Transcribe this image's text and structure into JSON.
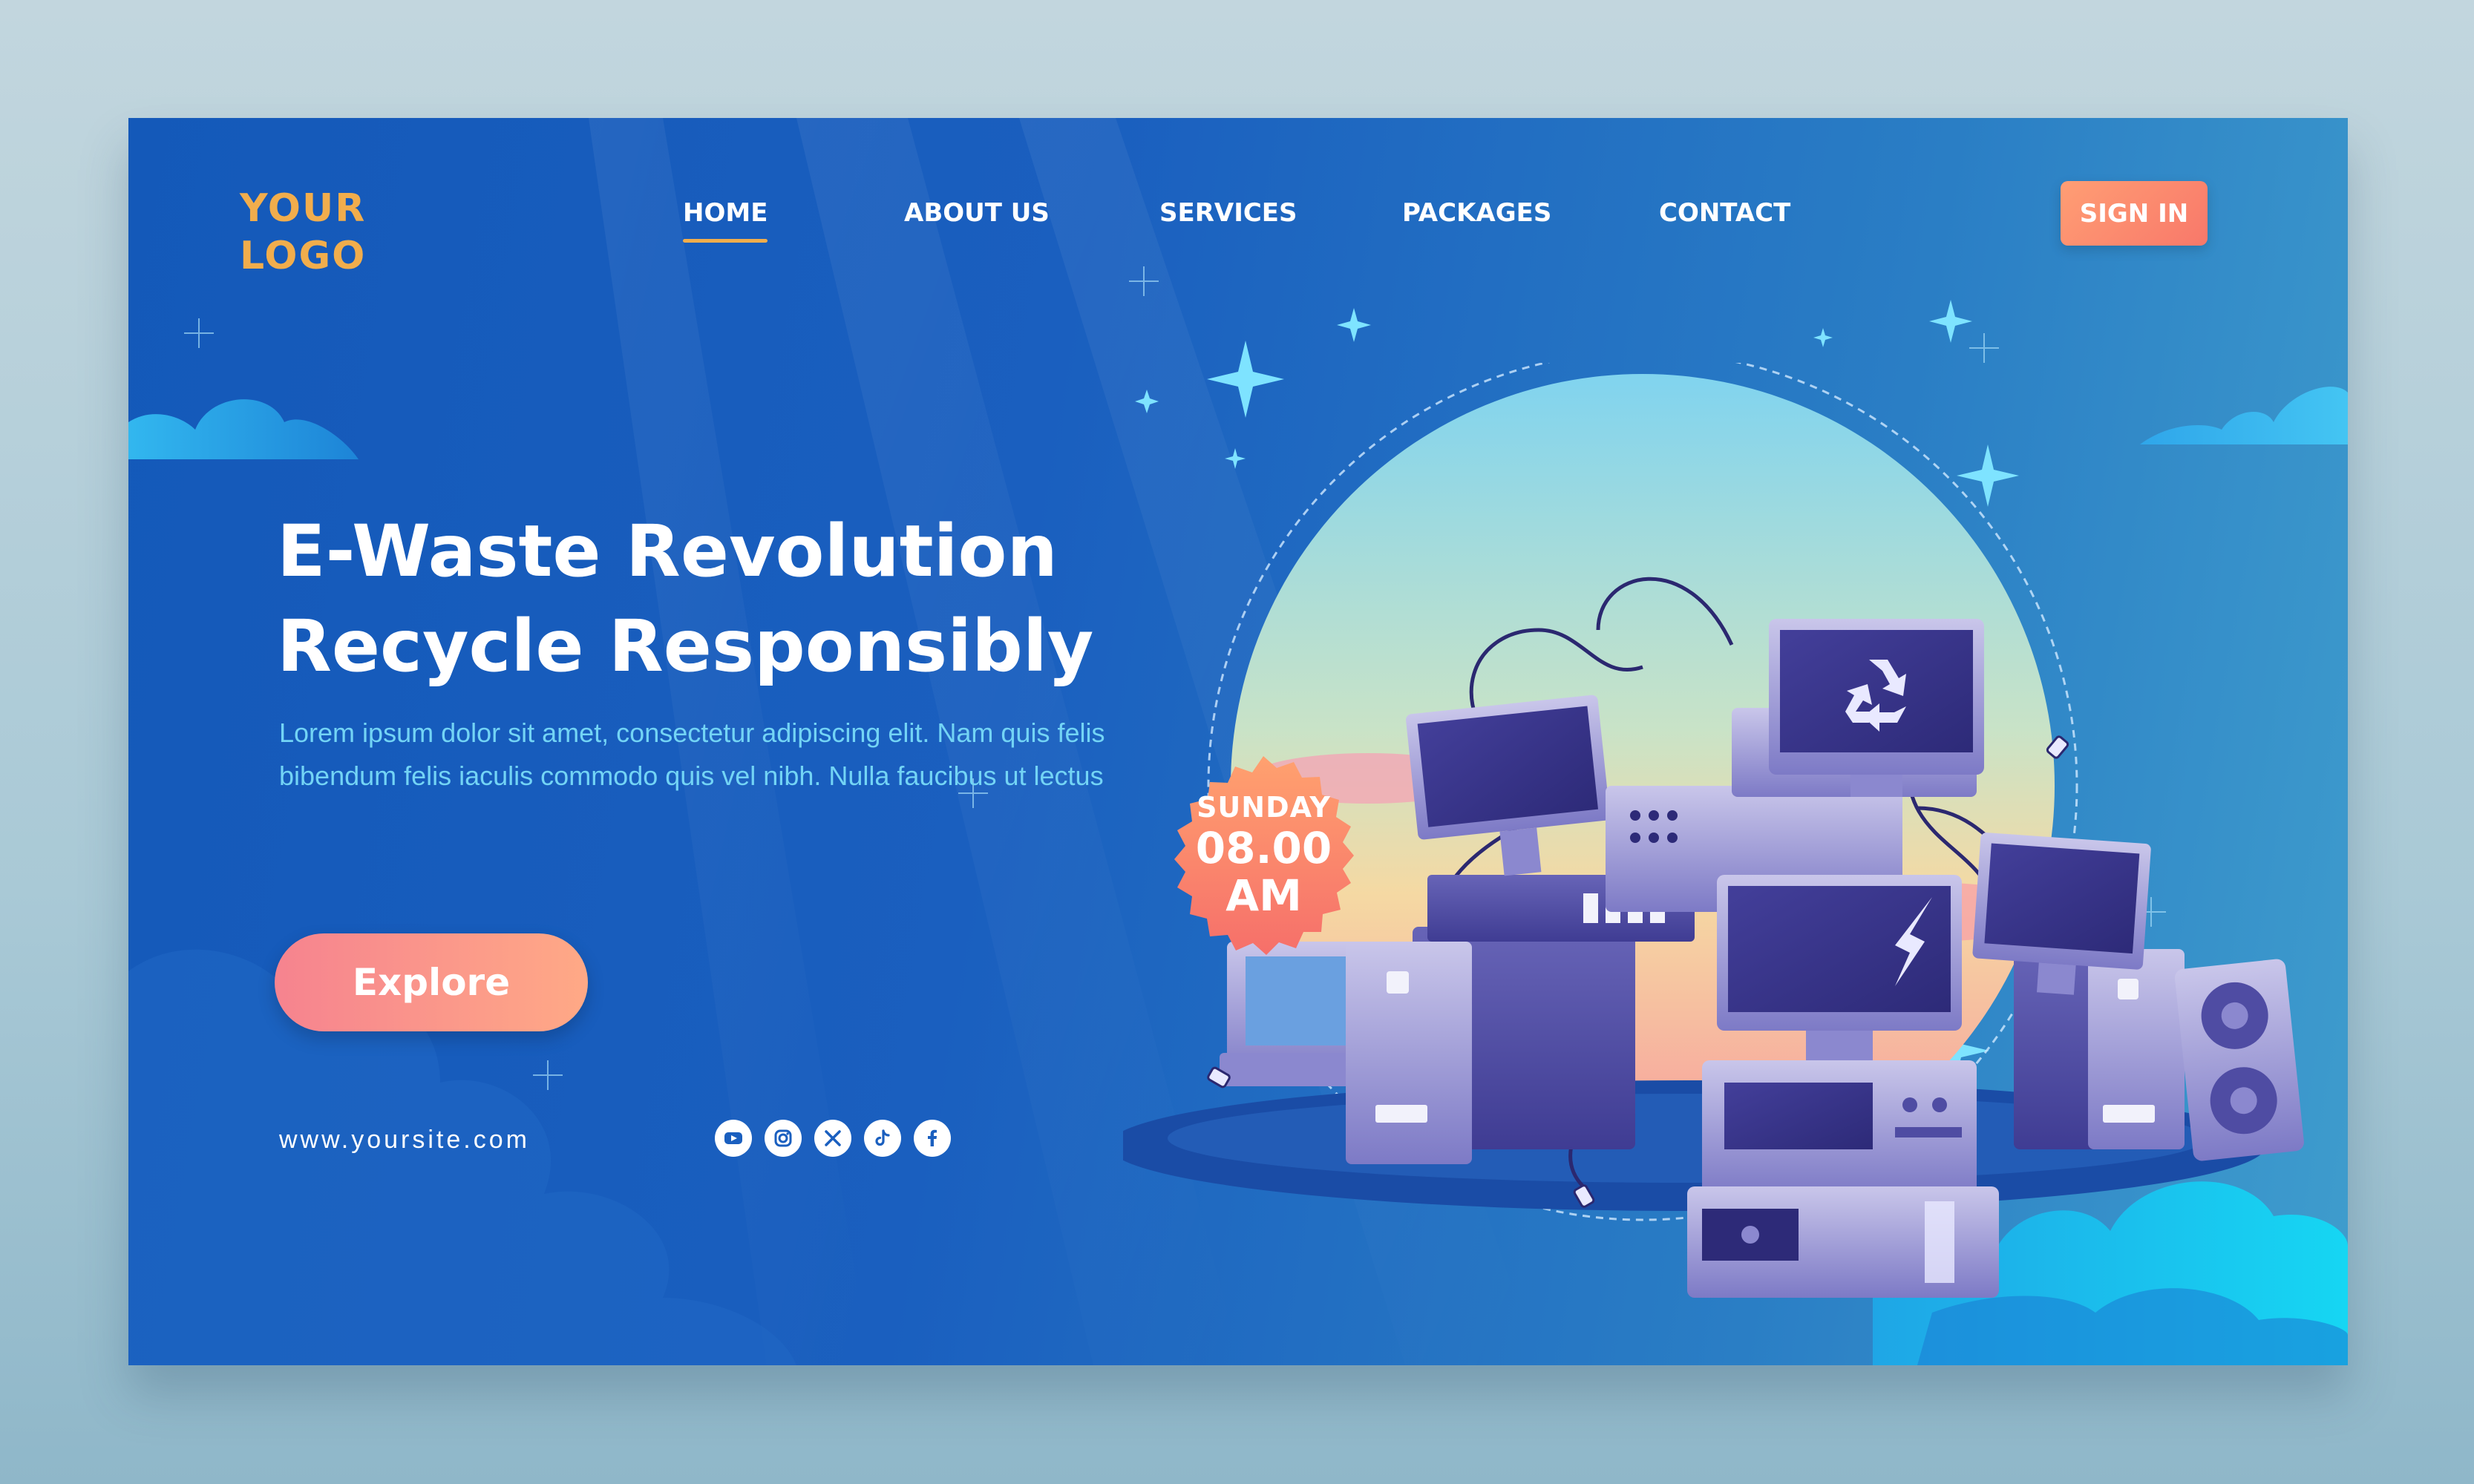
{
  "logo": {
    "text": "YOUR\nLOGO"
  },
  "nav": {
    "items": [
      {
        "label": "HOME",
        "active": true
      },
      {
        "label": "ABOUT US",
        "active": false
      },
      {
        "label": "SERVICES",
        "active": false
      },
      {
        "label": "PACKAGES",
        "active": false
      },
      {
        "label": "CONTACT",
        "active": false
      }
    ],
    "signin_label": "SIGN IN"
  },
  "hero": {
    "title_line1": "E-Waste Revolution",
    "title_line2": "Recycle Responsibly",
    "description": "Lorem ipsum dolor sit amet, consectetur adipiscing elit. Nam quis felis bibendum felis iaculis commodo quis vel nibh. Nulla faucibus ut lectus",
    "explore_label": "Explore"
  },
  "footer": {
    "website": "www.yoursite.com",
    "socials": [
      "youtube-icon",
      "instagram-icon",
      "x-icon",
      "tiktok-icon",
      "facebook-icon"
    ]
  },
  "badge": {
    "day": "SUNDAY",
    "time": "08.00",
    "period": "AM"
  },
  "colors": {
    "background": "#1a5fbf",
    "accent_orange": "#f1ad4c",
    "signin": "#f8786a",
    "explore_start": "#f6838f",
    "explore_end": "#ffa986",
    "subtext": "#73d4f5"
  }
}
